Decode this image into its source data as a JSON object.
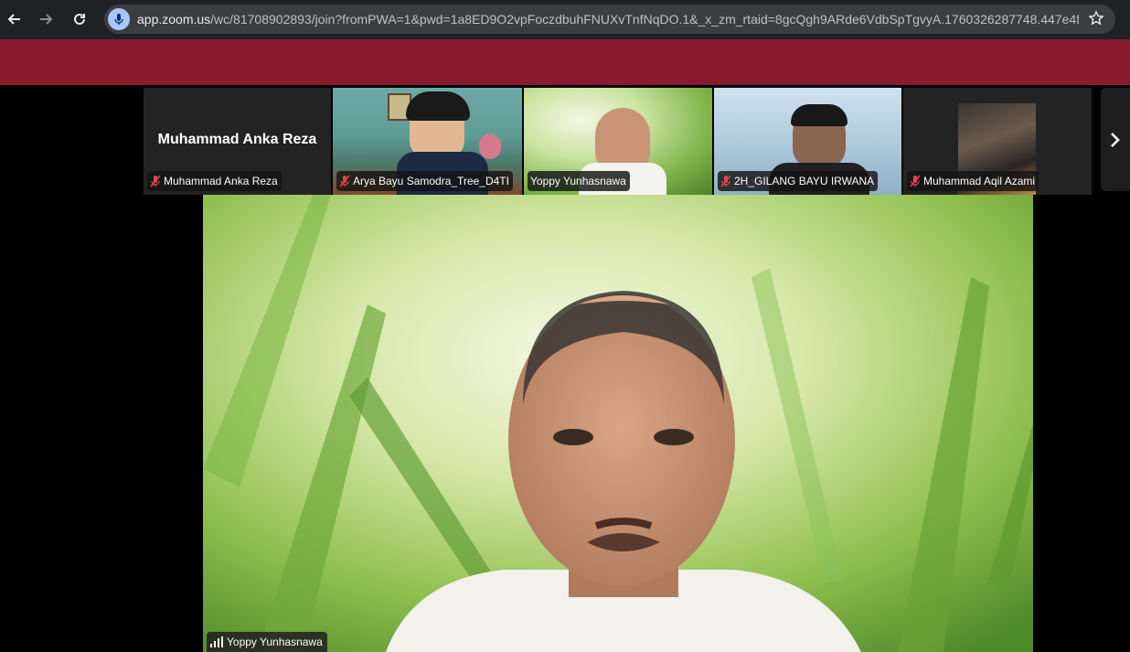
{
  "browser": {
    "url_host": "app.zoom.us",
    "url_path": "/wc/81708902893/join?fromPWA=1&pwd=1a8ED9O2vpFoczdbuhFNUXvTnfNqDO.1&_x_zm_rtaid=8gcQgh9ARde6VdbSpTgvyA.1760326287748.447e4f7...",
    "back_icon": "arrow-left-icon",
    "forward_icon": "arrow-right-icon",
    "reload_icon": "reload-icon",
    "mic_icon": "microphone-icon",
    "bookmark_icon": "star-icon"
  },
  "colors": {
    "banner": "#8a1a2f",
    "active_border": "#a7d65c",
    "muted_red": "#e8434a"
  },
  "participants": [
    {
      "name": "Muhammad Anka Reza",
      "display_name_big": "Muhammad Anka Reza",
      "muted": true,
      "video": false
    },
    {
      "name": "Arya Bayu Samodra_Tree_D4TI",
      "muted": true,
      "video": true
    },
    {
      "name": "Yoppy Yunhasnawa",
      "muted": false,
      "video": true,
      "active_speaker": true
    },
    {
      "name": "2H_GILANG BAYU IRWANA",
      "muted": true,
      "video": true
    },
    {
      "name": "Muhammad Aqil Azami",
      "muted": true,
      "video": true
    }
  ],
  "main_speaker": {
    "name": "Yoppy Yunhasnawa",
    "audio_icon": "audio-level-icon"
  },
  "next_page_icon": "chevron-right-icon"
}
